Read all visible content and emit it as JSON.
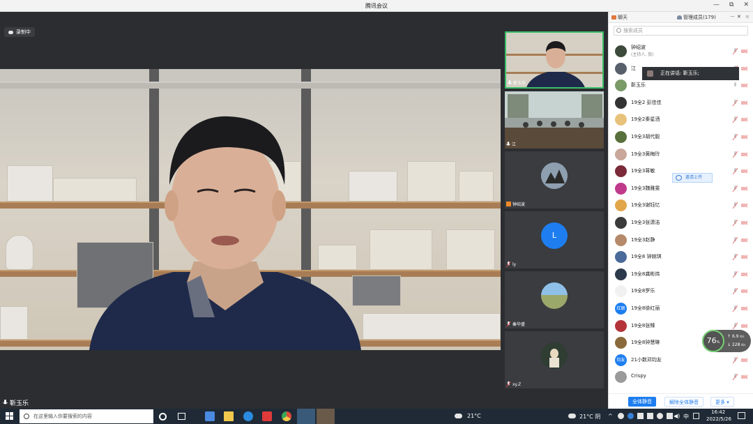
{
  "window": {
    "title": "腾讯会议",
    "minimize": "—",
    "restore": "⧉",
    "close": "✕"
  },
  "recording": {
    "label": "录制中"
  },
  "main_speaker": {
    "name": "靳玉乐"
  },
  "video_tiles": [
    {
      "name": "靳玉乐"
    },
    {
      "name": "江"
    },
    {
      "name": "钟绍波"
    },
    {
      "name": "ly",
      "avatar_letter": "L"
    },
    {
      "name": "秦华盛"
    },
    {
      "name": "xy.Z"
    }
  ],
  "panel": {
    "tab_chat": "聊天",
    "tab_members": "管理成员(179)",
    "more": "···",
    "close": "✕",
    "search_placeholder": "搜索成员",
    "talking_banner": "正在讲话: 靳玉乐;",
    "share_label": "邀请上传",
    "members": [
      {
        "name": "钟绍波",
        "sub": "(主持人, 我)",
        "color": "#3b4a3a"
      },
      {
        "name": "江",
        "color": "#57606b"
      },
      {
        "name": "靳玉乐",
        "color": "#7a9a68"
      },
      {
        "name": "19全2 彭佳佳",
        "color": "#333333"
      },
      {
        "name": "19全2秦星洒",
        "color": "#e8c27a"
      },
      {
        "name": "19全3胡代毅",
        "color": "#58703c"
      },
      {
        "name": "19全3黄梅玲",
        "color": "#c9a79a"
      },
      {
        "name": "19全3蒋敏",
        "color": "#7b2a3a"
      },
      {
        "name": "19全3魏雅雯",
        "color": "#c03a8c"
      },
      {
        "name": "19全3谢钰忆",
        "color": "#e2a64a"
      },
      {
        "name": "19全3张潇洁",
        "color": "#3b3b3b"
      },
      {
        "name": "19全3赵静",
        "color": "#b58a6a"
      },
      {
        "name": "19全8 钟婉琪",
        "color": "#4a6a9a"
      },
      {
        "name": "19全8龚彬炜",
        "color": "#2d3a4a"
      },
      {
        "name": "19全8罗乐",
        "color": "#f1f1f1"
      },
      {
        "name": "19全8徐红丽",
        "avatar_text": "红丽",
        "color": "#1e7ef0"
      },
      {
        "name": "19全8张臻",
        "color": "#b4343a"
      },
      {
        "name": "19全8钟慧琳",
        "color": "#8a6a3a"
      },
      {
        "name": "21小数邓钧友",
        "avatar_text": "钧友",
        "color": "#1e7ef0"
      },
      {
        "name": "Crispy",
        "color": "#9a9a9a"
      }
    ],
    "footer": {
      "mute_all": "全体静音",
      "unmute_all": "解除全体静音",
      "more": "更多"
    }
  },
  "speed_widget": {
    "percent": "76",
    "unit": "%",
    "up": "6.9",
    "up_unit": "K/s",
    "down": "228",
    "down_unit": "K/s"
  },
  "taskbar": {
    "search_placeholder": "在这里输入你要搜索的内容",
    "weather1": "21°C",
    "weather2": "21°C 阴",
    "ime": "中",
    "time": "16:42",
    "date": "2022/5/26"
  }
}
